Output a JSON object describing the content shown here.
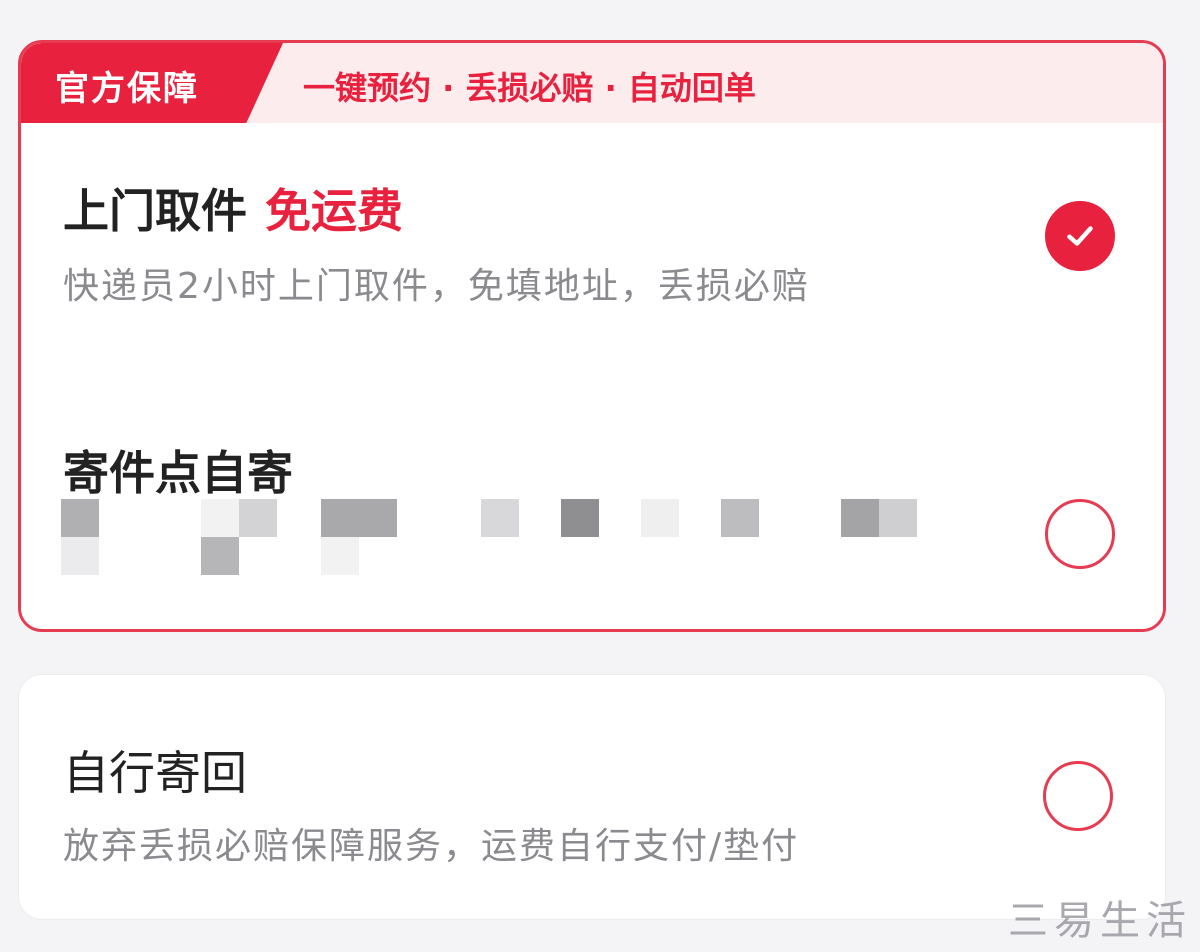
{
  "official_card": {
    "tag": "官方保障",
    "slogan": "一键预约 · 丢损必赔 · 自动回单",
    "options": [
      {
        "title": "上门取件",
        "highlight": "免运费",
        "description": "快递员2小时上门取件，免填地址，丢损必赔",
        "selected": true
      },
      {
        "title": "寄件点自寄",
        "selected": false
      }
    ]
  },
  "self_card": {
    "title": "自行寄回",
    "description": "放弃丢损必赔保障服务，运费自行支付/垫付",
    "selected": false
  },
  "icons": {
    "check": "check-icon"
  },
  "colors": {
    "accent": "#e8223e",
    "header_bg": "#fdecee",
    "text_primary": "#222222",
    "text_secondary": "#8a8a8f"
  },
  "watermark": "三易生活"
}
